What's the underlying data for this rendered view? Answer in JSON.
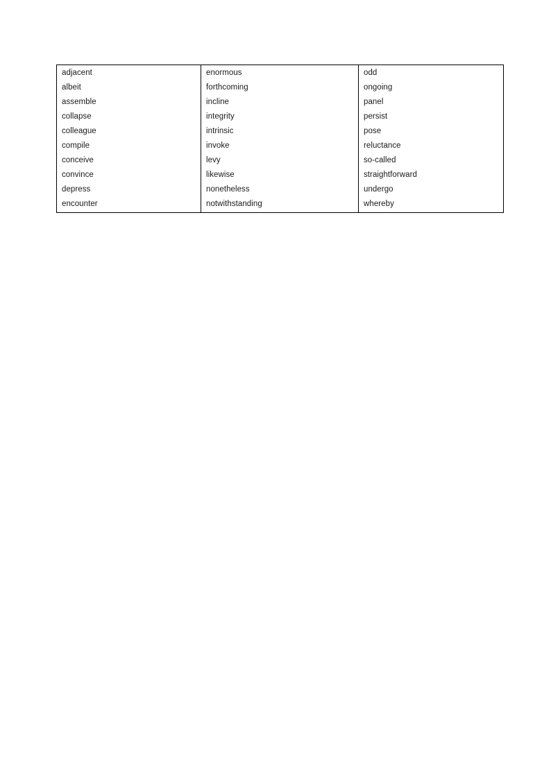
{
  "page": {
    "background_color": "#ffffff",
    "text_color": "#1a1a1a",
    "border_color": "#000000"
  },
  "table": {
    "columns": 3,
    "rows": 10,
    "rows_data": [
      [
        "adjacent",
        "enormous",
        "odd"
      ],
      [
        "albeit",
        "forthcoming",
        "ongoing"
      ],
      [
        "assemble",
        "incline",
        "panel"
      ],
      [
        "collapse",
        "integrity",
        "persist"
      ],
      [
        "colleague",
        "intrinsic",
        "pose"
      ],
      [
        "compile",
        "invoke",
        "reluctance"
      ],
      [
        "conceive",
        "levy",
        "so-called"
      ],
      [
        "convince",
        "likewise",
        "straightforward"
      ],
      [
        "depress",
        "nonetheless",
        "undergo"
      ],
      [
        "encounter",
        "notwithstanding",
        "whereby"
      ]
    ]
  }
}
